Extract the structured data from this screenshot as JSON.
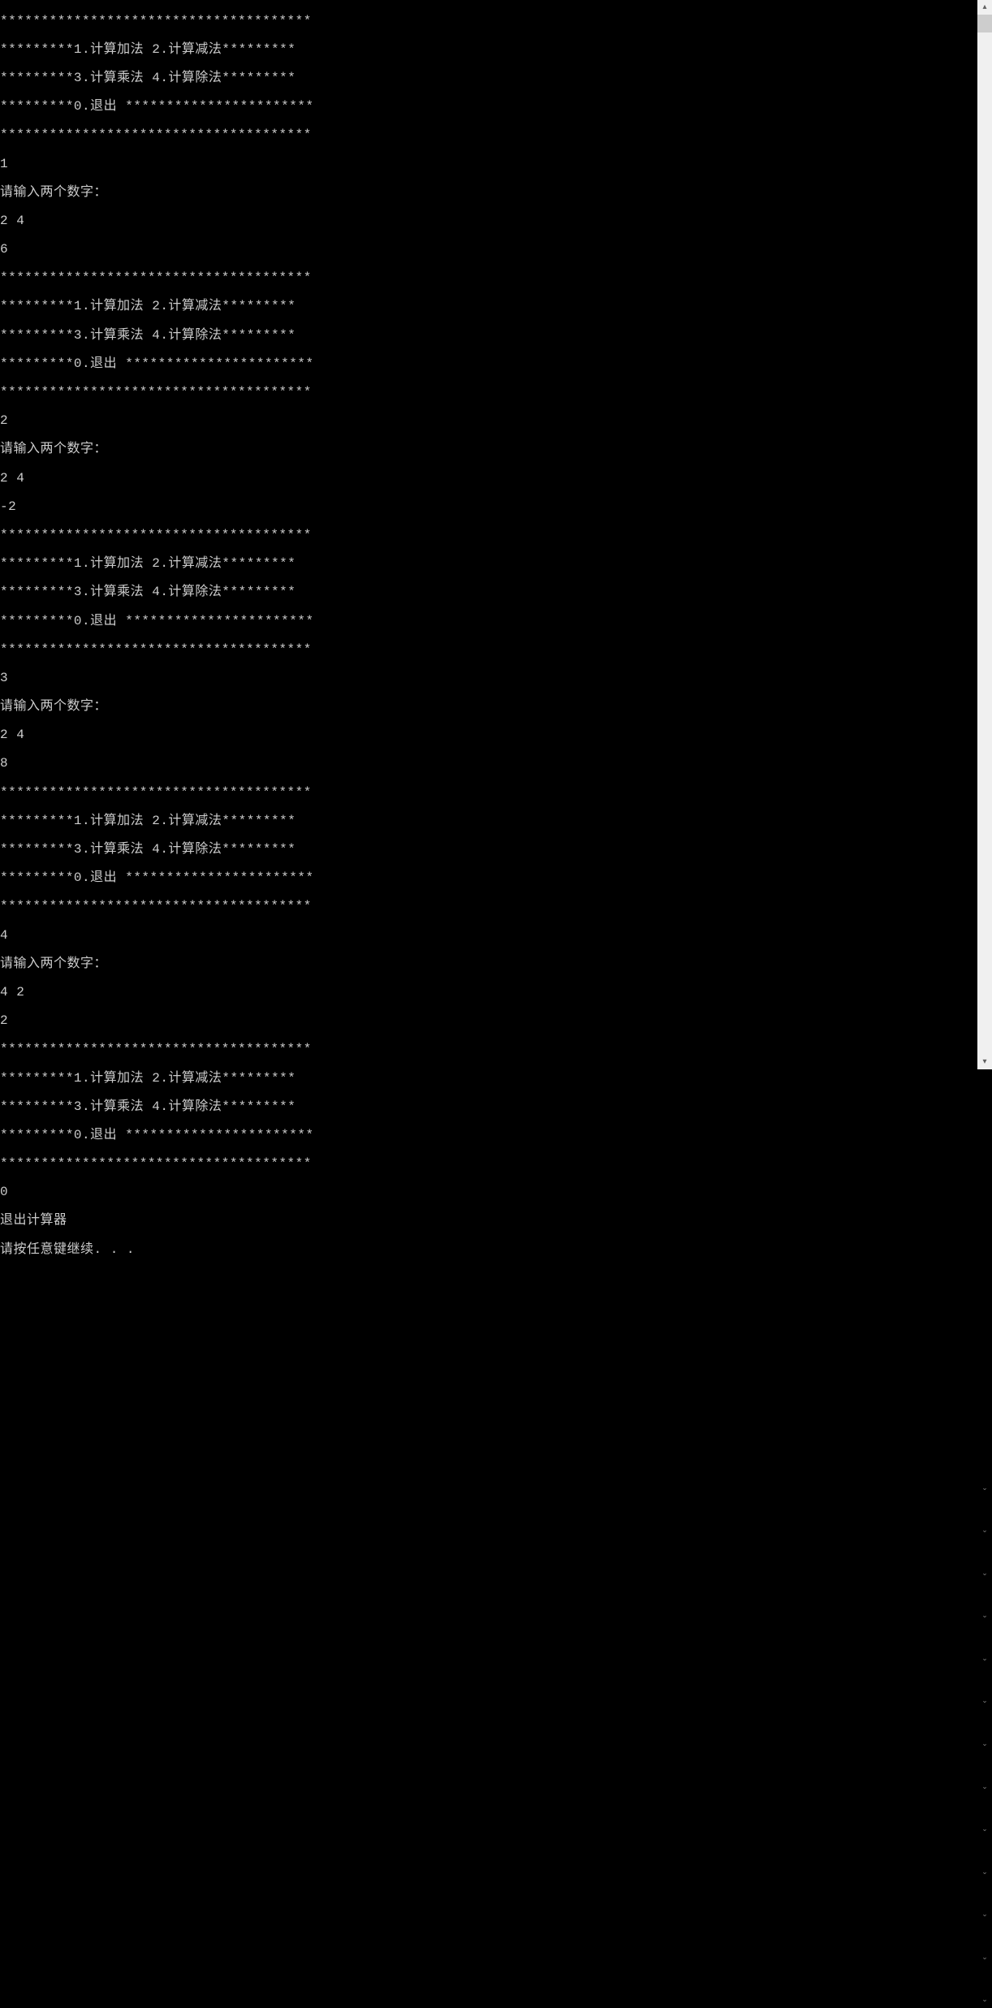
{
  "menu": {
    "border": "**************************************",
    "line1": "*********1.计算加法 2.计算减法*********",
    "line2": "*********3.计算乘法 4.计算除法*********",
    "line3": "*********0.退出 ***********************"
  },
  "sessions": [
    {
      "choice": "1",
      "prompt": "请输入两个数字：",
      "input": "2 4",
      "result": "6"
    },
    {
      "choice": "2",
      "prompt": "请输入两个数字：",
      "input": "2 4",
      "result": "-2"
    },
    {
      "choice": "3",
      "prompt": "请输入两个数字：",
      "input": "2 4",
      "result": "8"
    },
    {
      "choice": "4",
      "prompt": "请输入两个数字：",
      "input": "4 2",
      "result": "2"
    }
  ],
  "exit": {
    "choice": "0",
    "message": "退出计算器",
    "continue": "请按任意键继续. . ."
  },
  "scrollbar": {
    "up": "▴",
    "down": "▾",
    "chev": "⌄"
  }
}
